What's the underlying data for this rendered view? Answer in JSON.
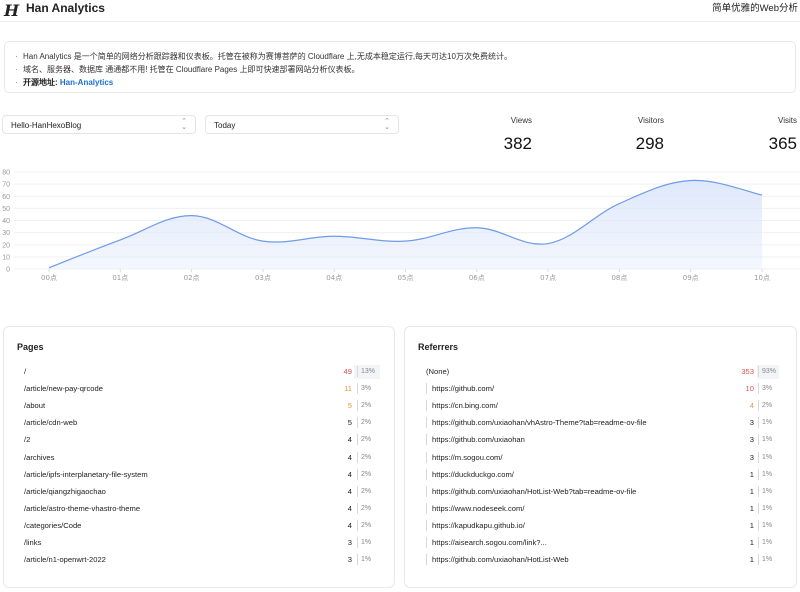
{
  "header": {
    "logo": "H",
    "title": "Han Analytics",
    "tagline": "简单优雅的Web分析"
  },
  "notice": {
    "line1": "Han Analytics 是一个简单的网络分析跟踪器和仪表板。托管在被称为赛博菩萨的 Cloudflare 上,无成本稳定运行,每天可达10万次免费统计。",
    "line2": "域名、服务器、数据库 通通都不用! 托管在 Cloudflare Pages 上即可快速部署网站分析仪表板。",
    "source_label": "开源地址:",
    "source_link": "Han-Analytics"
  },
  "filters": {
    "site": "Hello-HanHexoBlog",
    "range": "Today"
  },
  "stats": {
    "views_label": "Views",
    "views": "382",
    "visitors_label": "Visitors",
    "visitors": "298",
    "visits_label": "Visits",
    "visits": "365"
  },
  "colors": {
    "accent": "#6f9be8",
    "fill": "#dfe8fb",
    "count_red": "#d9534f",
    "count_orange": "#e8944a",
    "link": "#1d6fd6"
  },
  "chart_data": {
    "type": "area",
    "categories": [
      "00点",
      "01点",
      "02点",
      "03点",
      "04点",
      "05点",
      "06点",
      "07点",
      "08点",
      "09点",
      "10点"
    ],
    "values": [
      1,
      24,
      44,
      23,
      27,
      23,
      34,
      21,
      54,
      73,
      61
    ],
    "yticks": [
      0,
      10,
      20,
      30,
      40,
      50,
      60,
      70,
      80
    ],
    "ylim": [
      0,
      80
    ],
    "grid": true
  },
  "pages": {
    "title": "Pages",
    "rows": [
      {
        "path": "/",
        "count": "49",
        "pct": "13%",
        "tone": "red"
      },
      {
        "path": "/article/new-pay-qrcode",
        "count": "11",
        "pct": "3%",
        "tone": "orange"
      },
      {
        "path": "/about",
        "count": "5",
        "pct": "2%",
        "tone": "orange"
      },
      {
        "path": "/article/cdn-web",
        "count": "5",
        "pct": "2%",
        "tone": ""
      },
      {
        "path": "/2",
        "count": "4",
        "pct": "2%",
        "tone": ""
      },
      {
        "path": "/archives",
        "count": "4",
        "pct": "2%",
        "tone": ""
      },
      {
        "path": "/article/ipfs-interplanetary-file-system",
        "count": "4",
        "pct": "2%",
        "tone": ""
      },
      {
        "path": "/article/qiangzhigaochao",
        "count": "4",
        "pct": "2%",
        "tone": ""
      },
      {
        "path": "/article/astro-theme-vhastro-theme",
        "count": "4",
        "pct": "2%",
        "tone": ""
      },
      {
        "path": "/categories/Code",
        "count": "4",
        "pct": "2%",
        "tone": ""
      },
      {
        "path": "/links",
        "count": "3",
        "pct": "1%",
        "tone": ""
      },
      {
        "path": "/article/n1-openwrt-2022",
        "count": "3",
        "pct": "1%",
        "tone": ""
      }
    ]
  },
  "referrers": {
    "title": "Referrers",
    "rows": [
      {
        "source": "(None)",
        "count": "353",
        "pct": "93%",
        "tone": "red"
      },
      {
        "source": "https://github.com/",
        "count": "10",
        "pct": "3%",
        "tone": "red"
      },
      {
        "source": "https://cn.bing.com/",
        "count": "4",
        "pct": "2%",
        "tone": "orange"
      },
      {
        "source": "https://github.com/uxiaohan/vhAstro-Theme?tab=readme-ov-file",
        "count": "3",
        "pct": "1%",
        "tone": ""
      },
      {
        "source": "https://github.com/uxiaohan",
        "count": "3",
        "pct": "1%",
        "tone": ""
      },
      {
        "source": "https://m.sogou.com/",
        "count": "3",
        "pct": "1%",
        "tone": ""
      },
      {
        "source": "https://duckduckgo.com/",
        "count": "1",
        "pct": "1%",
        "tone": ""
      },
      {
        "source": "https://github.com/uxiaohan/HotList-Web?tab=readme-ov-file",
        "count": "1",
        "pct": "1%",
        "tone": ""
      },
      {
        "source": "https://www.nodeseek.com/",
        "count": "1",
        "pct": "1%",
        "tone": ""
      },
      {
        "source": "https://kapudkapu.github.io/",
        "count": "1",
        "pct": "1%",
        "tone": ""
      },
      {
        "source": "https://aisearch.sogou.com/link?...",
        "count": "1",
        "pct": "1%",
        "tone": ""
      },
      {
        "source": "https://github.com/uxiaohan/HotList-Web",
        "count": "1",
        "pct": "1%",
        "tone": ""
      }
    ]
  }
}
